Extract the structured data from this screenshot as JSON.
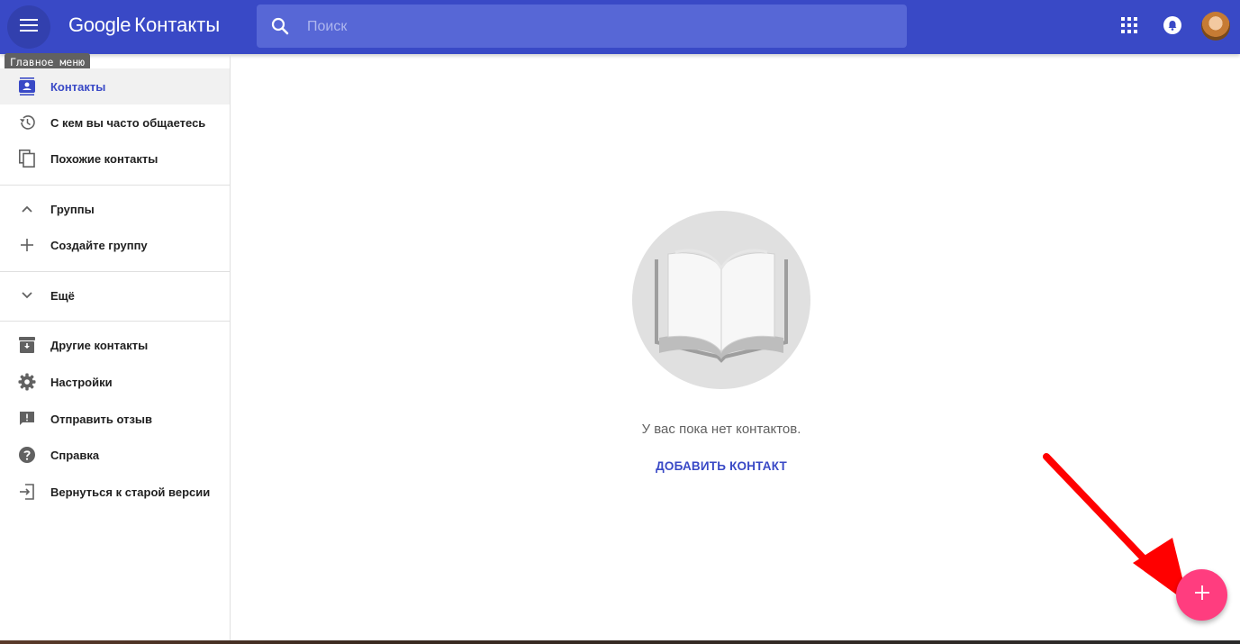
{
  "header": {
    "brand": "Google",
    "product": "Контакты",
    "menu_tooltip": "Главное меню",
    "search_placeholder": "Поиск"
  },
  "sidebar": {
    "items": [
      {
        "label": "Контакты",
        "icon": "contacts-icon",
        "active": true
      },
      {
        "label": "С кем вы часто общаетесь",
        "icon": "history-icon"
      },
      {
        "label": "Похожие контакты",
        "icon": "copy-icon"
      },
      {
        "label": "Группы",
        "icon": "chevron-up-icon"
      },
      {
        "label": "Создайте группу",
        "icon": "plus-icon"
      },
      {
        "label": "Ещё",
        "icon": "chevron-down-icon"
      },
      {
        "label": "Другие контакты",
        "icon": "archive-icon"
      },
      {
        "label": "Настройки",
        "icon": "gear-icon"
      },
      {
        "label": "Отправить отзыв",
        "icon": "feedback-icon"
      },
      {
        "label": "Справка",
        "icon": "help-icon"
      },
      {
        "label": "Вернуться к старой версии",
        "icon": "exit-icon"
      }
    ]
  },
  "main": {
    "empty_message": "У вас пока нет контактов.",
    "add_contact_label": "ДОБАВИТЬ КОНТАКТ"
  },
  "colors": {
    "header": "#3949c6",
    "accent": "#3949c6",
    "fab": "#ff3d7f",
    "annotation_arrow": "#ff0000"
  }
}
